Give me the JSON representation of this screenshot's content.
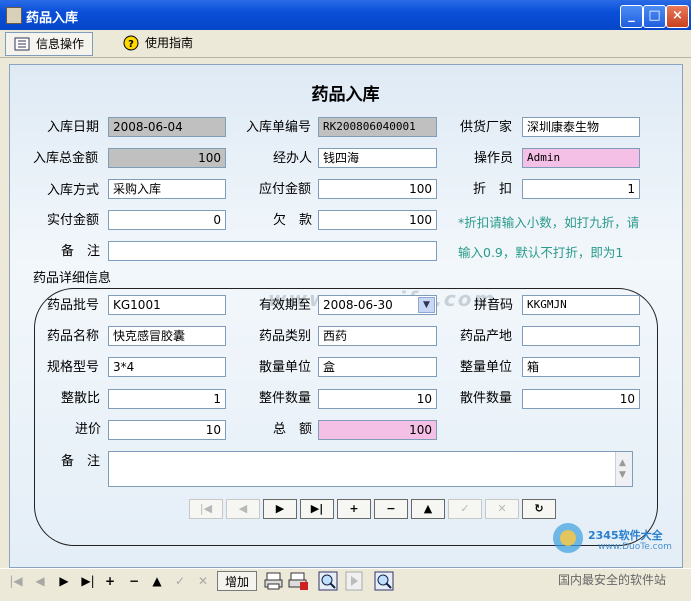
{
  "window": {
    "title": "药品入库",
    "min_glyph": "_",
    "max_glyph": "□",
    "close_glyph": "×"
  },
  "tabs": [
    {
      "label": "信息操作"
    },
    {
      "label": "使用指南"
    }
  ],
  "form": {
    "heading": "药品入库",
    "labels": {
      "in_date": "入库日期",
      "in_no": "入库单编号",
      "supplier": "供货厂家",
      "total_amount": "入库总金额",
      "handler": "经办人",
      "operator": "操作员",
      "in_method": "入库方式",
      "payable": "应付金额",
      "discount": "折　扣",
      "paid": "实付金额",
      "owed": "欠　款",
      "remark": "备　注",
      "detail_section": "药品详细信息"
    },
    "values": {
      "in_date": "2008-06-04",
      "in_no": "RK200806040001",
      "supplier": "深圳康泰生物",
      "total_amount": "100",
      "handler": "钱四海",
      "operator": "Admin",
      "in_method": "采购入库",
      "payable": "100",
      "discount": "1",
      "paid": "0",
      "owed": "100",
      "remark": ""
    },
    "discount_note_line1": "*折扣请输入小数，如打九折，请",
    "discount_note_line2": "输入0.9，默认不打折，即为1"
  },
  "detail": {
    "labels": {
      "batch_no": "药品批号",
      "expiry": "有效期至",
      "pinyin": "拼音码",
      "name": "药品名称",
      "category": "药品类别",
      "origin": "药品产地",
      "spec": "规格型号",
      "unit_loose": "散量单位",
      "unit_whole": "整量单位",
      "ratio": "整散比",
      "whole_qty": "整件数量",
      "loose_qty": "散件数量",
      "price": "进价",
      "total": "总　额",
      "remark": "备　注"
    },
    "values": {
      "batch_no": "KG1001",
      "expiry": "2008-06-30",
      "pinyin": "KKGMJN",
      "name": "快克感冒胶囊",
      "category": "西药",
      "origin": "",
      "spec": "3*4",
      "unit_loose": "盒",
      "unit_whole": "箱",
      "ratio": "1",
      "whole_qty": "10",
      "loose_qty": "10",
      "price": "10",
      "total": "100",
      "remark": ""
    },
    "nav_buttons": [
      "|◀",
      "◀",
      "▶",
      "▶|",
      "+",
      "−",
      "▲",
      "✓",
      "✕",
      "↻"
    ],
    "nav_enabled": [
      false,
      false,
      true,
      true,
      true,
      true,
      true,
      false,
      false,
      true
    ]
  },
  "bottom_toolbar": {
    "nav": [
      "|◀",
      "◀",
      "▶",
      "▶|",
      "+",
      "−",
      "▲",
      "✓",
      "✕"
    ],
    "add_label": "增加"
  },
  "watermark": {
    "mid": "www.sunxifo.com",
    "logo": "2345软件大全",
    "url": "www.DuoTe.com",
    "tagline": "国内最安全的软件站"
  },
  "colors": {
    "titlebar": "#0a4fd8",
    "readonly_gray": "#c0c0c0",
    "highlight_pink": "#f5c0e5",
    "note_teal": "#2a9a8a"
  }
}
